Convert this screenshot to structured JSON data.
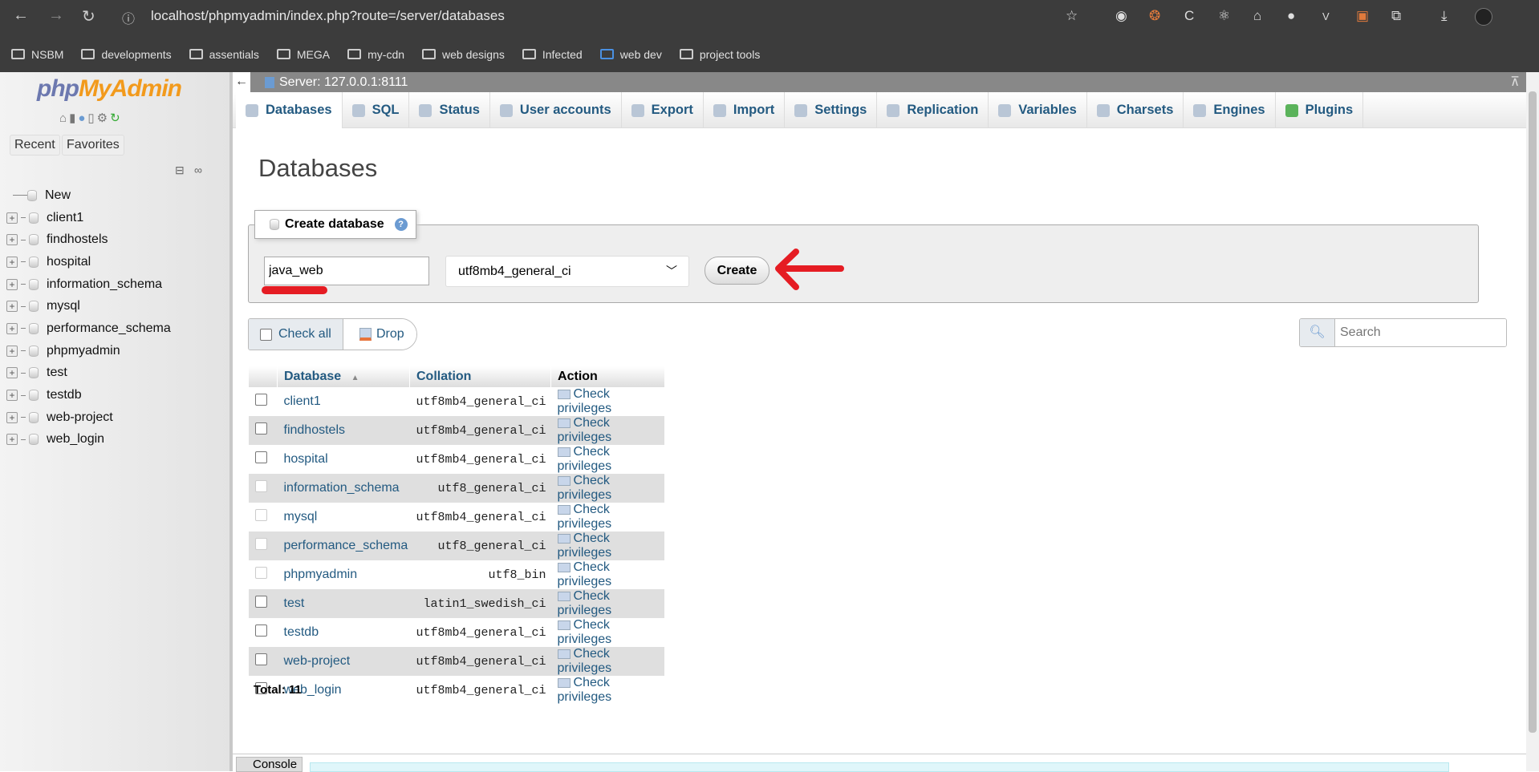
{
  "browser": {
    "url": "localhost/phpmyadmin/index.php?route=/server/databases",
    "bookmarks": [
      "NSBM",
      "developments",
      "assentials",
      "MEGA",
      "my-cdn",
      "web designs",
      "Infected",
      "web dev",
      "project tools"
    ]
  },
  "sidebar": {
    "logo": "phpMyAdmin",
    "recent": "Recent",
    "favorites": "Favorites",
    "new": "New",
    "databases": [
      "client1",
      "findhostels",
      "hospital",
      "information_schema",
      "mysql",
      "performance_schema",
      "phpmyadmin",
      "test",
      "testdb",
      "web-project",
      "web_login"
    ]
  },
  "server": {
    "label": "Server: 127.0.0.1:8111"
  },
  "tabs": [
    "Databases",
    "SQL",
    "Status",
    "User accounts",
    "Export",
    "Import",
    "Settings",
    "Replication",
    "Variables",
    "Charsets",
    "Engines",
    "Plugins"
  ],
  "page": {
    "title": "Databases"
  },
  "create": {
    "legend": "Create database",
    "name_value": "java_web",
    "collation": "utf8mb4_general_ci",
    "button": "Create"
  },
  "actions": {
    "check_all": "Check all",
    "drop": "Drop",
    "search_placeholder": "Search"
  },
  "table": {
    "headers": [
      "Database",
      "Collation",
      "Action"
    ],
    "rows": [
      {
        "db": "client1",
        "coll": "utf8mb4_general_ci",
        "action": "Check privileges",
        "disabled": false
      },
      {
        "db": "findhostels",
        "coll": "utf8mb4_general_ci",
        "action": "Check privileges",
        "disabled": false
      },
      {
        "db": "hospital",
        "coll": "utf8mb4_general_ci",
        "action": "Check privileges",
        "disabled": false
      },
      {
        "db": "information_schema",
        "coll": "utf8_general_ci",
        "action": "Check privileges",
        "disabled": true
      },
      {
        "db": "mysql",
        "coll": "utf8mb4_general_ci",
        "action": "Check privileges",
        "disabled": true
      },
      {
        "db": "performance_schema",
        "coll": "utf8_general_ci",
        "action": "Check privileges",
        "disabled": true
      },
      {
        "db": "phpmyadmin",
        "coll": "utf8_bin",
        "action": "Check privileges",
        "disabled": true
      },
      {
        "db": "test",
        "coll": "latin1_swedish_ci",
        "action": "Check privileges",
        "disabled": false
      },
      {
        "db": "testdb",
        "coll": "utf8mb4_general_ci",
        "action": "Check privileges",
        "disabled": false
      },
      {
        "db": "web-project",
        "coll": "utf8mb4_general_ci",
        "action": "Check privileges",
        "disabled": false
      },
      {
        "db": "web_login",
        "coll": "utf8mb4_general_ci",
        "action": "Check privileges",
        "disabled": false
      }
    ]
  },
  "total": "Total: 11",
  "console": "Console",
  "colors": {
    "link": "#235a81",
    "annotation": "#e51c23"
  }
}
